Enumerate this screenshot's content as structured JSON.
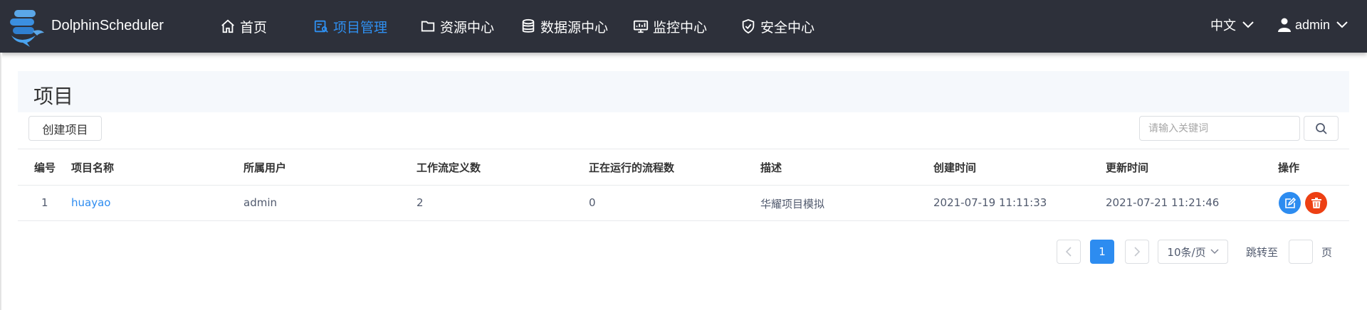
{
  "brand": {
    "name": "DolphinScheduler"
  },
  "nav": {
    "items": [
      {
        "label": "首页",
        "icon": "home-icon"
      },
      {
        "label": "项目管理",
        "icon": "project-icon",
        "active": true
      },
      {
        "label": "资源中心",
        "icon": "folder-icon"
      },
      {
        "label": "数据源中心",
        "icon": "database-icon"
      },
      {
        "label": "监控中心",
        "icon": "monitor-icon"
      },
      {
        "label": "安全中心",
        "icon": "shield-icon"
      }
    ],
    "language": "中文",
    "user": "admin"
  },
  "page": {
    "title": "项目"
  },
  "toolbar": {
    "create_label": "创建项目",
    "search_placeholder": "请输入关键词",
    "search_value": ""
  },
  "table": {
    "columns": [
      "编号",
      "项目名称",
      "所属用户",
      "工作流定义数",
      "正在运行的流程数",
      "描述",
      "创建时间",
      "更新时间",
      "操作"
    ],
    "rows": [
      {
        "id": "1",
        "name": "huayao",
        "owner": "admin",
        "workflow_count": "2",
        "running_count": "0",
        "description": "华耀项目模拟",
        "created": "2021-07-19 11:11:33",
        "updated": "2021-07-21 11:21:46"
      }
    ]
  },
  "pagination": {
    "current_page": "1",
    "page_size": "10条/页",
    "jump_label": "跳转至",
    "page_label": "页",
    "jump_value": ""
  },
  "colors": {
    "topbar": "#2d303a",
    "accent": "#2d8cf0",
    "danger": "#ed4014",
    "header_bg": "#f5f8fc"
  }
}
